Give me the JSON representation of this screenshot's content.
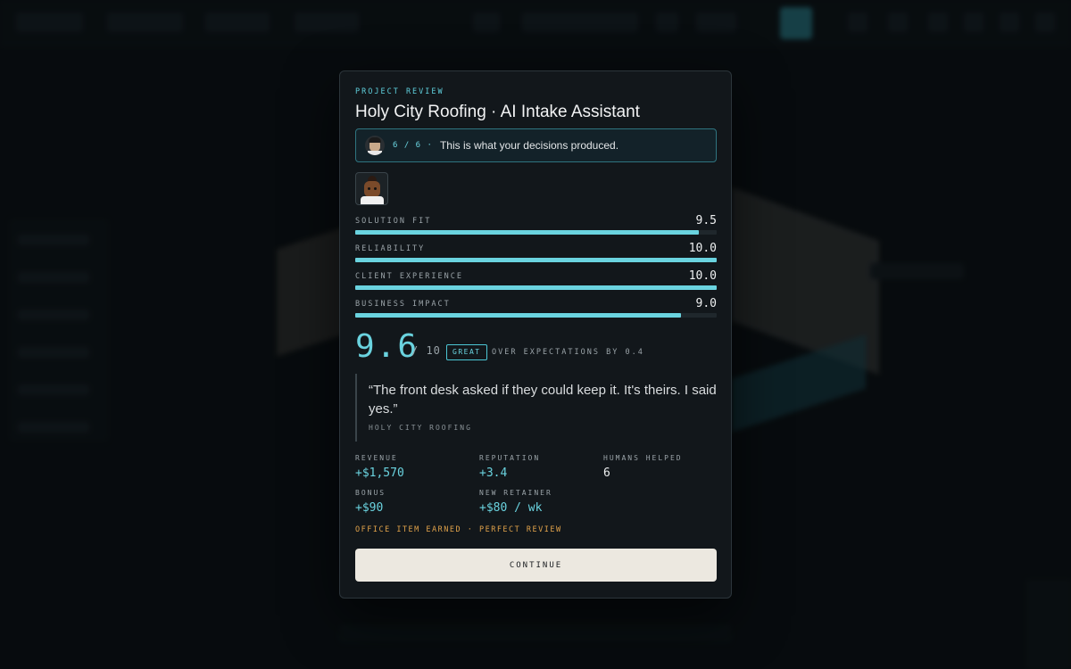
{
  "modal": {
    "eyebrow": "PROJECT REVIEW",
    "title": "Holy City Roofing · AI Intake Assistant",
    "progress": {
      "step": "6 / 6 ·",
      "message": "This is what your decisions produced."
    },
    "metrics": [
      {
        "label": "SOLUTION FIT",
        "value": "9.5",
        "fraction": 0.95
      },
      {
        "label": "RELIABILITY",
        "value": "10.0",
        "fraction": 1.0
      },
      {
        "label": "CLIENT EXPERIENCE",
        "value": "10.0",
        "fraction": 1.0
      },
      {
        "label": "BUSINESS IMPACT",
        "value": "9.0",
        "fraction": 0.9
      }
    ],
    "score": {
      "value": "9.6",
      "max": "/ 10",
      "badge": "GREAT",
      "note": "OVER EXPECTATIONS BY 0.4"
    },
    "quote": {
      "text": "“The front desk asked if they could keep it. It's theirs. I said yes.”",
      "source": "HOLY CITY ROOFING"
    },
    "stats": {
      "revenue": {
        "label": "REVENUE",
        "value": "+$1,570"
      },
      "reputation": {
        "label": "REPUTATION",
        "value": "+3.4"
      },
      "humans_helped": {
        "label": "HUMANS HELPED",
        "value": "6"
      },
      "bonus": {
        "label": "BONUS",
        "value": "+$90"
      },
      "new_retainer": {
        "label": "NEW RETAINER",
        "value": "+$80 / wk"
      }
    },
    "earned": "OFFICE ITEM EARNED · PERFECT REVIEW",
    "continue_label": "CONTINUE"
  },
  "colors": {
    "accent": "#6ad3df",
    "earned": "#e0a24a",
    "button_bg": "#ece8e0"
  }
}
